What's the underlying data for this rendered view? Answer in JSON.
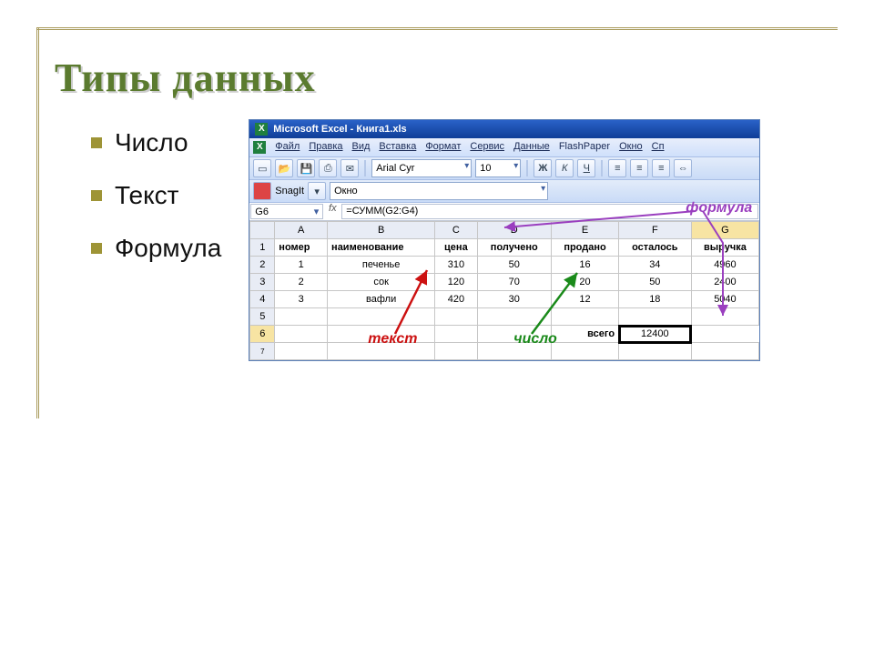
{
  "slide": {
    "title": "Типы данных",
    "bullets": [
      "Число",
      "Текст",
      "Формула"
    ]
  },
  "excel": {
    "titlebar": "Microsoft Excel - Книга1.xls",
    "menus": [
      "Файл",
      "Правка",
      "Вид",
      "Вставка",
      "Формат",
      "Сервис",
      "Данные",
      "FlashPaper",
      "Окно",
      "Сп"
    ],
    "font_name": "Arial Cyr",
    "font_size": "10",
    "snagit_label": "SnagIt",
    "snagit_combo": "Окно",
    "name_box": "G6",
    "fx_label": "fx",
    "formula_bar": "=СУММ(G2:G4)",
    "columns": [
      "A",
      "B",
      "C",
      "D",
      "E",
      "F",
      "G"
    ],
    "headers": [
      "номер",
      "наименование",
      "цена",
      "получено",
      "продано",
      "осталось",
      "выручка"
    ],
    "rows": [
      {
        "n": "1",
        "cells": [
          "1",
          "печенье",
          "310",
          "50",
          "16",
          "34",
          "4960"
        ]
      },
      {
        "n": "2",
        "cells": [
          "2",
          "сок",
          "120",
          "70",
          "20",
          "50",
          "2400"
        ]
      },
      {
        "n": "3",
        "cells": [
          "3",
          "вафли",
          "420",
          "30",
          "12",
          "18",
          "5040"
        ]
      }
    ],
    "total_row": {
      "n": "6",
      "label": "всего",
      "value": "12400",
      "label_col": "F",
      "value_col": "G"
    },
    "empty_rows": [
      "5"
    ],
    "tail_row": "7"
  },
  "annotations": {
    "formula": "формула",
    "text": "текст",
    "number": "число"
  },
  "style_buttons": {
    "bold": "Ж",
    "italic": "К",
    "underline": "Ч"
  }
}
